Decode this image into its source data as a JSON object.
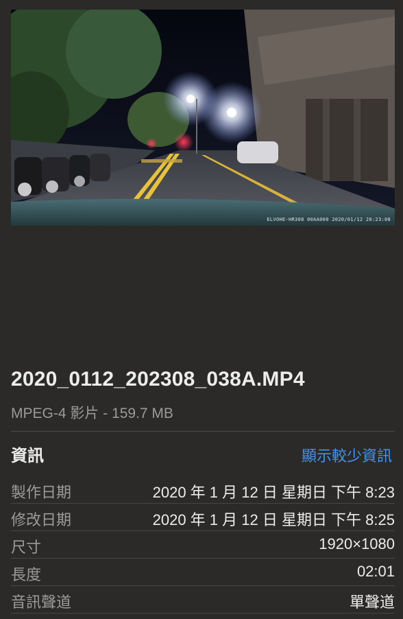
{
  "preview": {
    "osd_text": "ELVOHE-HR308 00AA000 2020/01/12 20:23:08"
  },
  "file": {
    "name": "2020_0112_202308_038A.MP4",
    "kind_size": "MPEG-4 影片 - 159.7 MB"
  },
  "info": {
    "title": "資訊",
    "toggle_label": "顯示較少資訊",
    "rows": [
      {
        "label": "製作日期",
        "value": "2020 年 1 月 12 日 星期日 下午 8:23"
      },
      {
        "label": "修改日期",
        "value": "2020 年 1 月 12 日 星期日 下午 8:25"
      },
      {
        "label": "尺寸",
        "value": "1920×1080"
      },
      {
        "label": "長度",
        "value": "02:01"
      },
      {
        "label": "音訊聲道",
        "value": "單聲道"
      }
    ]
  },
  "colors": {
    "background": "#2b2a29",
    "link": "#3d94f6",
    "secondary_text": "#9b9b9b"
  }
}
